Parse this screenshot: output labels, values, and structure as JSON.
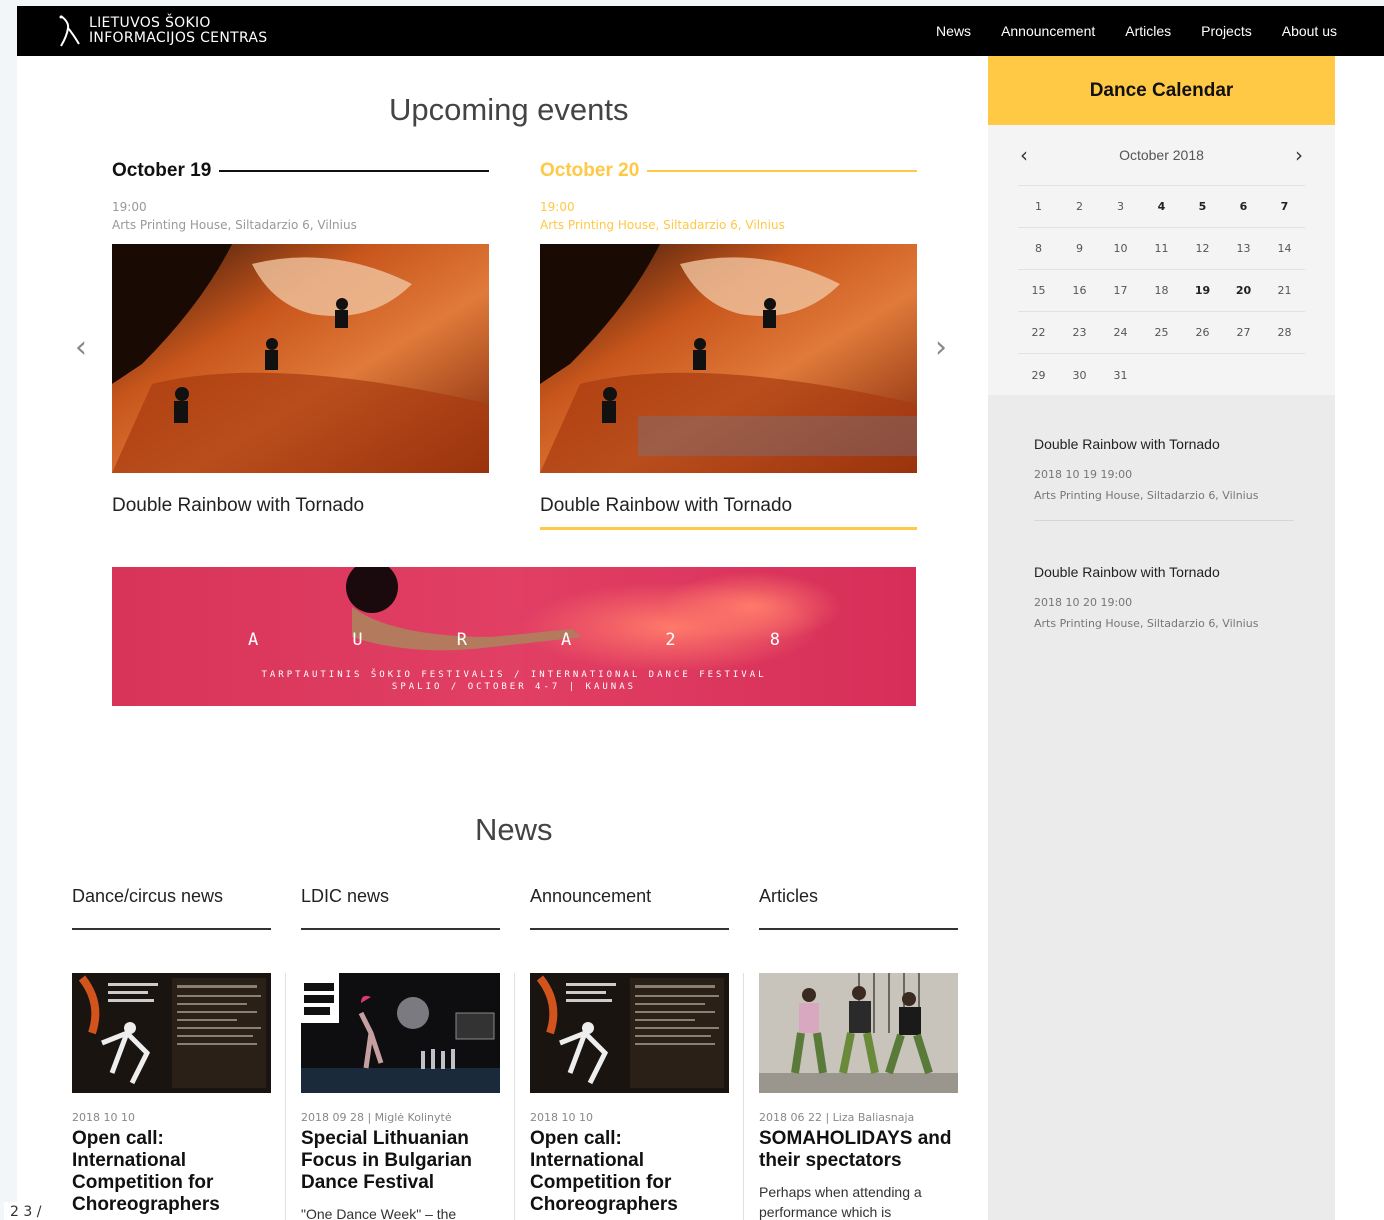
{
  "brand": {
    "line1": "LIETUVOS ŠOKIO",
    "line2": "INFORMACIJOS CENTRAS"
  },
  "nav": [
    "News",
    "Announcement",
    "Articles",
    "Projects",
    "About us"
  ],
  "upcoming": {
    "title": "Upcoming events",
    "events": [
      {
        "date": "October 19",
        "time": "19:00",
        "place": "Arts Printing House, Siltadarzio 6, Vilnius",
        "name": "Double Rainbow with Tornado"
      },
      {
        "date": "October 20",
        "time": "19:00",
        "place": "Arts Printing House, Siltadarzio 6, Vilnius",
        "name": "Double Rainbow with Tornado"
      }
    ],
    "prev": "‹",
    "next": "›"
  },
  "banner": {
    "letters": [
      "A",
      "U",
      "R",
      "A",
      "2",
      "8"
    ],
    "line1": "TARPTAUTINIS ŠOKIO FESTIVALIS / INTERNATIONAL DANCE FESTIVAL",
    "line2": "SPALIO / OCTOBER 4-7 | KAUNAS"
  },
  "calendar": {
    "title": "Dance Calendar",
    "month": "October 2018",
    "prev": "‹",
    "next": "›",
    "weeks": [
      [
        "1",
        "2",
        "3",
        "4",
        "5",
        "6",
        "7"
      ],
      [
        "8",
        "9",
        "10",
        "11",
        "12",
        "13",
        "14"
      ],
      [
        "15",
        "16",
        "17",
        "18",
        "19",
        "20",
        "21"
      ],
      [
        "22",
        "23",
        "24",
        "25",
        "26",
        "27",
        "28"
      ],
      [
        "29",
        "30",
        "31"
      ]
    ],
    "events": [
      {
        "title": "Double Rainbow with Tornado",
        "datetime": "2018 10 19 19:00",
        "place": "Arts Printing House, Siltadarzio 6, Vilnius"
      },
      {
        "title": "Double Rainbow with Tornado",
        "datetime": "2018 10 20 19:00",
        "place": "Arts Printing House, Siltadarzio 6, Vilnius"
      }
    ]
  },
  "news": {
    "title": "News",
    "tabs": [
      "Dance/circus news",
      "LDIC news",
      "Announcement",
      "Articles"
    ],
    "cards": [
      {
        "meta": "2018 10 10",
        "title": "Open call: International Competition for Choreographers",
        "excerpt": ""
      },
      {
        "meta": "2018 09 28 | Miglė Kolinytė",
        "title": "Special Lithuanian Focus in Bulgarian Dance Festival",
        "excerpt": "\"One Dance Week\" – the"
      },
      {
        "meta": "2018 10 10",
        "title": "Open call: International Competition for Choreographers",
        "excerpt": ""
      },
      {
        "meta": "2018 06 22 | Liza Baliasnaja",
        "title": "SOMAHOLIDAYS and their spectators",
        "excerpt": "Perhaps when attending a performance which is"
      }
    ]
  },
  "corner": "2 3 /",
  "colors": {
    "accent": "#ffc845",
    "topbar": "#000000"
  }
}
